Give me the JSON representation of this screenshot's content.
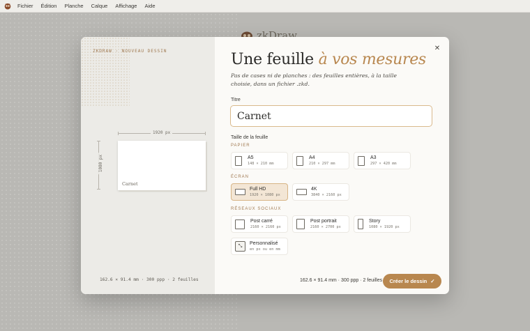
{
  "menubar": {
    "items": [
      "Fichier",
      "Édition",
      "Planche",
      "Calque",
      "Affichage",
      "Aide"
    ]
  },
  "background": {
    "brand": "zkDraw"
  },
  "dialog": {
    "eyebrow": "ZKDRAW · NOUVEAU DESSIN",
    "heading_plain": "Une feuille ",
    "heading_accent": "à vos mesures",
    "subtitle": "Pas de cases ni de planches : des feuilles entières, à la taille choisie, dans un fichier .zkd.",
    "title_label": "Titre",
    "title_value": "Carnet",
    "size_label": "Taille de la feuille",
    "preview": {
      "width_label": "1920 px",
      "height_label": "1080 px",
      "paper_title": "Carnet",
      "footer": "162.6 × 91.4 mm · 300 ppp · 2 feuilles"
    },
    "sections": {
      "paper": {
        "label": "PAPIER",
        "items": [
          {
            "name": "A5",
            "dims": "148 × 210 mm"
          },
          {
            "name": "A4",
            "dims": "210 × 297 mm"
          },
          {
            "name": "A3",
            "dims": "297 × 420 mm"
          }
        ]
      },
      "screen": {
        "label": "ÉCRAN",
        "items": [
          {
            "name": "Full HD",
            "dims": "1920 × 1080 px",
            "selected": true
          },
          {
            "name": "4K",
            "dims": "3840 × 2160 px"
          }
        ]
      },
      "social": {
        "label": "RÉSEAUX SOCIAUX",
        "items": [
          {
            "name": "Post carré",
            "dims": "2160 × 2160 px"
          },
          {
            "name": "Post portrait",
            "dims": "2160 × 2700 px"
          },
          {
            "name": "Story",
            "dims": "1080 × 1920 px"
          },
          {
            "name": "Personnalisé",
            "dims": "en px ou en mm"
          }
        ]
      }
    },
    "footer_summary": "162.6 × 91.4 mm · 300 ppp · 2 feuilles",
    "create_label": "Créer le dessin",
    "accent_color": "#b8874f"
  }
}
